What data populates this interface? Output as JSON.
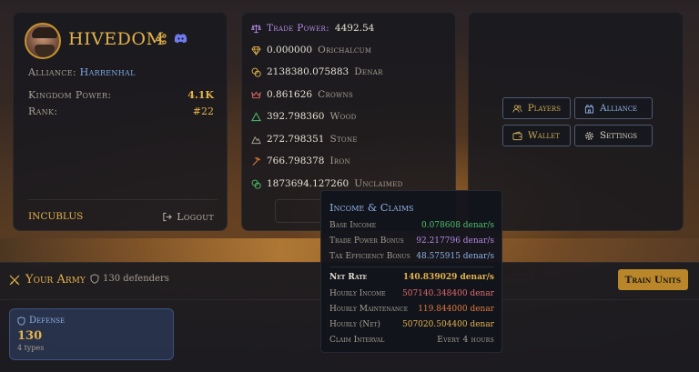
{
  "profile": {
    "name": "HIVEDOM",
    "alliance_label": "Alliance:",
    "alliance_value": "Harrenhal",
    "kingdom_power_label": "Kingdom Power:",
    "kingdom_power_value": "4.1K",
    "rank_label": "Rank:",
    "rank_value": "#22",
    "username": "INCUBLUS",
    "logout_label": "Logout"
  },
  "resources": [
    {
      "icon": "scale-icon",
      "value": "4492.54",
      "label": "Trade Power:",
      "color": "#b68be8"
    },
    {
      "icon": "diamond-icon",
      "value": "0.000000",
      "label": "Orichalcum",
      "color": "#e3b34a"
    },
    {
      "icon": "coins-icon",
      "value": "2138380.075883",
      "label": "Denar",
      "color": "#e3b34a"
    },
    {
      "icon": "crown-icon",
      "value": "0.861626",
      "label": "Crowns",
      "color": "#e06a6a"
    },
    {
      "icon": "tree-icon",
      "value": "392.798360",
      "label": "Wood",
      "color": "#4cc06a"
    },
    {
      "icon": "mountain-icon",
      "value": "272.798351",
      "label": "Stone",
      "color": "#a79f91"
    },
    {
      "icon": "pickaxe-icon",
      "value": "766.798378",
      "label": "Iron",
      "color": "#e07a3a"
    },
    {
      "icon": "coins-green-icon",
      "value": "1873694.127260",
      "label": "Unclaimed",
      "color": "#4cc06a"
    }
  ],
  "nav": {
    "players": "Players",
    "alliance": "Alliance",
    "wallet": "Wallet",
    "settings": "Settings"
  },
  "army": {
    "title": "Your Army",
    "defenders": "130 defenders",
    "train_label": "Train Units",
    "defense": {
      "title": "Defense",
      "value": "130",
      "types": "4 types"
    }
  },
  "tooltip": {
    "title": "Income & Claims",
    "rows": [
      {
        "label": "Base Income",
        "value": "0.078608 denar/s",
        "color": "#4cc06a"
      },
      {
        "label": "Trade Power Bonus",
        "value": "92.217796 denar/s",
        "color": "#b68be8"
      },
      {
        "label": "Tax Efficiency Bonus",
        "value": "48.575915 denar/s",
        "color": "#8fb2e6"
      },
      {
        "label": "Net Rate",
        "value": "140.839029 denar/s",
        "color": "#e3b34a"
      },
      {
        "label": "Hourly Income",
        "value": "507140.348400 denar",
        "color": "#e06a6a"
      },
      {
        "label": "Hourly Maintenance",
        "value": "119.844000 denar",
        "color": "#e07a3a"
      },
      {
        "label": "Hourly (Net)",
        "value": "507020.504400 denar",
        "color": "#e3b34a"
      },
      {
        "label": "Claim Interval",
        "value": "Every 4 hours",
        "color": "#a79f91"
      }
    ]
  }
}
